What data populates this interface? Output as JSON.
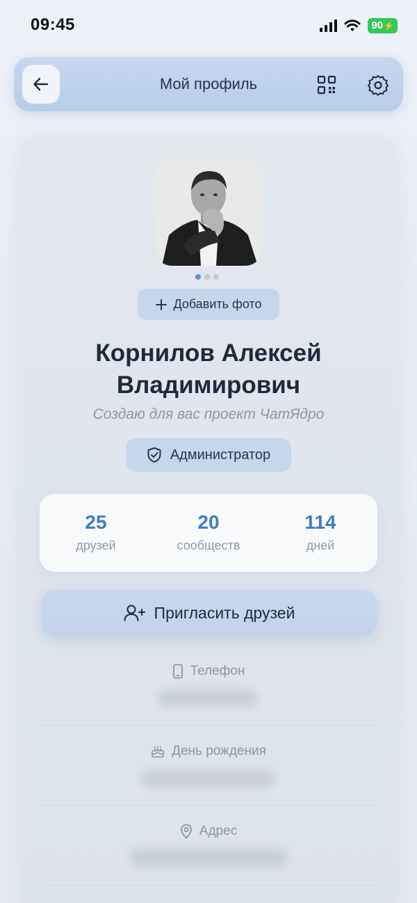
{
  "status": {
    "time": "09:45",
    "battery": "90"
  },
  "header": {
    "title": "Мой профиль"
  },
  "profile": {
    "add_photo": "Добавить фото",
    "name_line1": "Корнилов Алексей",
    "name_line2": "Владимирович",
    "bio": "Создаю для вас проект ЧатЯдро",
    "role": "Администратор"
  },
  "stats": [
    {
      "value": "25",
      "label": "друзей"
    },
    {
      "value": "20",
      "label": "сообществ"
    },
    {
      "value": "114",
      "label": "дней"
    }
  ],
  "invite": {
    "label": "Пригласить друзей"
  },
  "info": {
    "phone_label": "Телефон",
    "birthday_label": "День рождения",
    "address_label": "Адрес"
  },
  "colors": {
    "accent": "#3e7cc4",
    "battery": "#34c759",
    "header_bg": "#b8cde9"
  },
  "photo_pages": {
    "current": 1,
    "total": 3
  }
}
